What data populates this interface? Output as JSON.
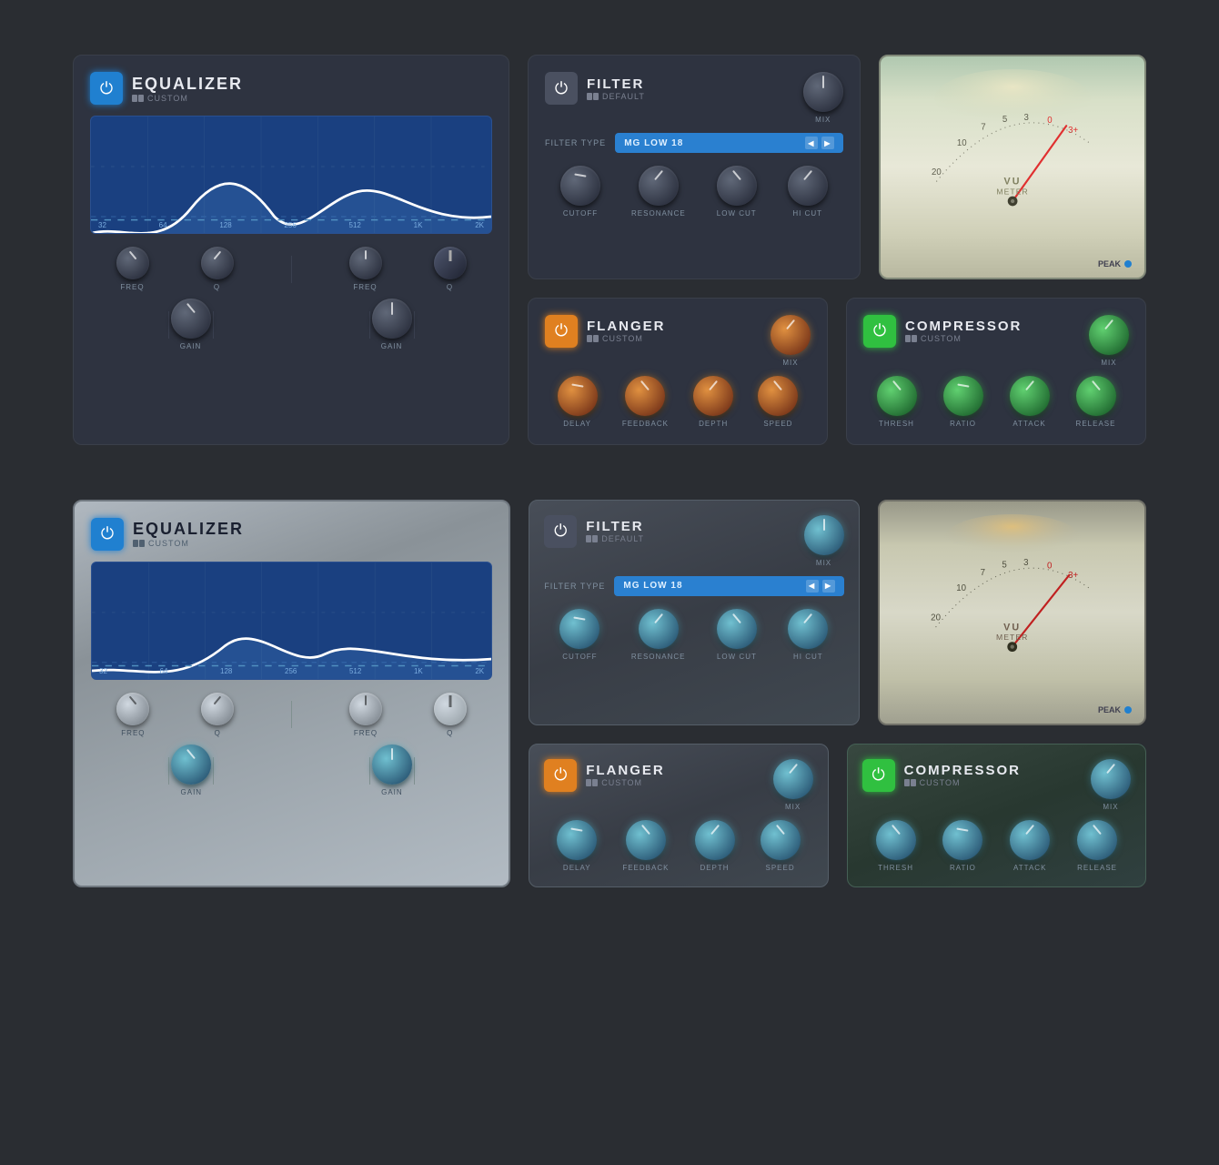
{
  "top_row": {
    "equalizer": {
      "power_state": "on",
      "title": "EQUALIZER",
      "subtitle": "CUSTOM",
      "freq_labels": [
        "32",
        "64",
        "128",
        "256",
        "512",
        "1K",
        "2K"
      ],
      "controls": {
        "freq1_label": "FREQ",
        "q1_label": "Q",
        "freq2_label": "FREQ",
        "q2_label": "Q",
        "gain1_label": "GAIN",
        "gain2_label": "GAIN"
      }
    },
    "filter": {
      "power_state": "off",
      "title": "FILTER",
      "subtitle": "DEFAULT",
      "filter_type_label": "FILTER TYPE",
      "filter_value": "MG LOW 18",
      "mix_label": "MIX",
      "knobs": [
        "CUTOFF",
        "RESONANCE",
        "LOW CUT",
        "HI CUT"
      ]
    },
    "vu_meter": {
      "scale": [
        "20",
        "10",
        "7",
        "5",
        "3",
        "0",
        "3+"
      ],
      "label": "VU\nMETER",
      "peak_label": "PEAK"
    },
    "flanger": {
      "power_state": "on",
      "title": "FLANGER",
      "subtitle": "CUSTOM",
      "mix_label": "MIX",
      "knobs": [
        "DELAY",
        "FEEDBACK",
        "DEPTH",
        "SPEED"
      ]
    },
    "compressor": {
      "power_state": "on",
      "title": "COMPRESSOR",
      "subtitle": "CUSTOM",
      "mix_label": "MIX",
      "knobs": [
        "THRESH",
        "RATIO",
        "ATTACK",
        "RELEASE"
      ]
    }
  },
  "bottom_row": {
    "equalizer": {
      "power_state": "on",
      "title": "EQUALIZER",
      "subtitle": "CUSTOM",
      "freq_labels": [
        "32",
        "64",
        "128",
        "256",
        "512",
        "1K",
        "2K"
      ],
      "controls": {
        "freq1_label": "FREQ",
        "q1_label": "Q",
        "freq2_label": "FREQ",
        "q2_label": "Q",
        "gain1_label": "GAIN",
        "gain2_label": "GAIN"
      }
    },
    "filter": {
      "power_state": "off",
      "title": "FILTER",
      "subtitle": "DEFAULT",
      "filter_type_label": "FILTER TYPE",
      "filter_value": "MG LOW 18",
      "mix_label": "MIX",
      "knobs": [
        "CUTOFF",
        "RESONANCE",
        "LOW CUT",
        "HI CUT"
      ]
    },
    "vu_meter": {
      "scale": [
        "20",
        "10",
        "7",
        "5",
        "3",
        "0",
        "3+"
      ],
      "label": "VU\nMETER",
      "peak_label": "PEAK"
    },
    "flanger": {
      "power_state": "on",
      "title": "FLANGER",
      "subtitle": "CUSTOM",
      "mix_label": "MIX",
      "knobs": [
        "DELAY",
        "FEEDBACK",
        "DEPTH",
        "SPEED"
      ]
    },
    "compressor": {
      "power_state": "on",
      "title": "COMPRESSOR",
      "subtitle": "CUSTOM",
      "mix_label": "MIX",
      "knobs": [
        "THRESH",
        "RATIO",
        "ATTACK",
        "RELEASE"
      ]
    }
  }
}
